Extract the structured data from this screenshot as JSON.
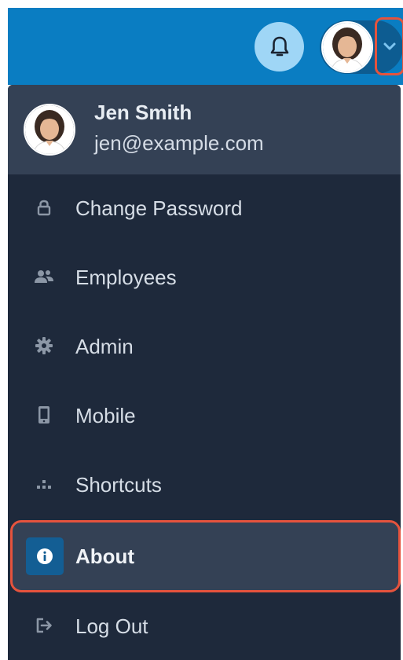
{
  "header": {
    "bell_icon": "bell-icon",
    "avatar_icon": "user-avatar",
    "dropdown_icon": "chevron-down-icon"
  },
  "profile": {
    "name": "Jen Smith",
    "email": "jen@example.com"
  },
  "menu": {
    "items": [
      {
        "label": "Change Password",
        "icon": "lock-icon"
      },
      {
        "label": "Employees",
        "icon": "users-icon"
      },
      {
        "label": "Admin",
        "icon": "gear-icon"
      },
      {
        "label": "Mobile",
        "icon": "mobile-icon"
      },
      {
        "label": "Shortcuts",
        "icon": "shortcuts-icon"
      },
      {
        "label": "About",
        "icon": "info-icon",
        "selected": true
      },
      {
        "label": "Log Out",
        "icon": "logout-icon"
      }
    ]
  },
  "colors": {
    "topbar": "#0a7dc2",
    "menu_bg": "#1e293b",
    "selected_bg": "#344155",
    "highlight": "#e5533d"
  }
}
